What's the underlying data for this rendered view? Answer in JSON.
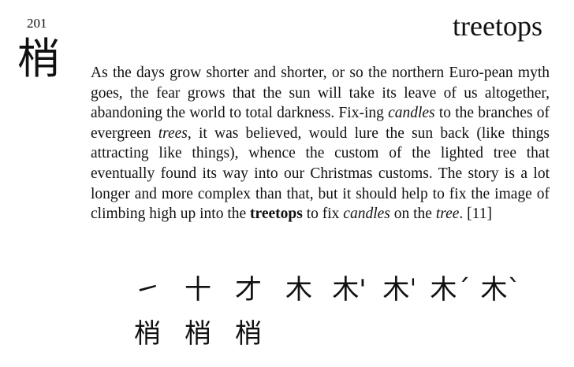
{
  "frame_number": "201",
  "keyword": "treetops",
  "kanji": "梢",
  "story": {
    "s1": "As the days grow shorter and shorter, or so the northern Euro-pean myth goes, the fear grows that the sun will take its leave of us altogether, abandoning the world to total darkness. Fix-ing ",
    "s2": "candles",
    "s3": " to the branches of evergreen ",
    "s4": "trees",
    "s5": ", it was believed, would lure the sun back (like things attracting like things), whence the custom of the lighted tree that eventually found its way into our Christmas customs. The story is a lot longer and more complex than that, but it should help to fix the image of climbing high up into the ",
    "s6": "treetops",
    "s7": " to fix ",
    "s8": "candles",
    "s9": " on the ",
    "s10": "tree",
    "s11": ". [11]"
  },
  "stroke_order": {
    "row1": [
      "㇀",
      "十",
      "才",
      "木",
      "木'",
      "木ˈ",
      "木ˊ",
      "木ˋ"
    ],
    "row2": [
      "梢",
      "梢",
      "梢"
    ]
  }
}
